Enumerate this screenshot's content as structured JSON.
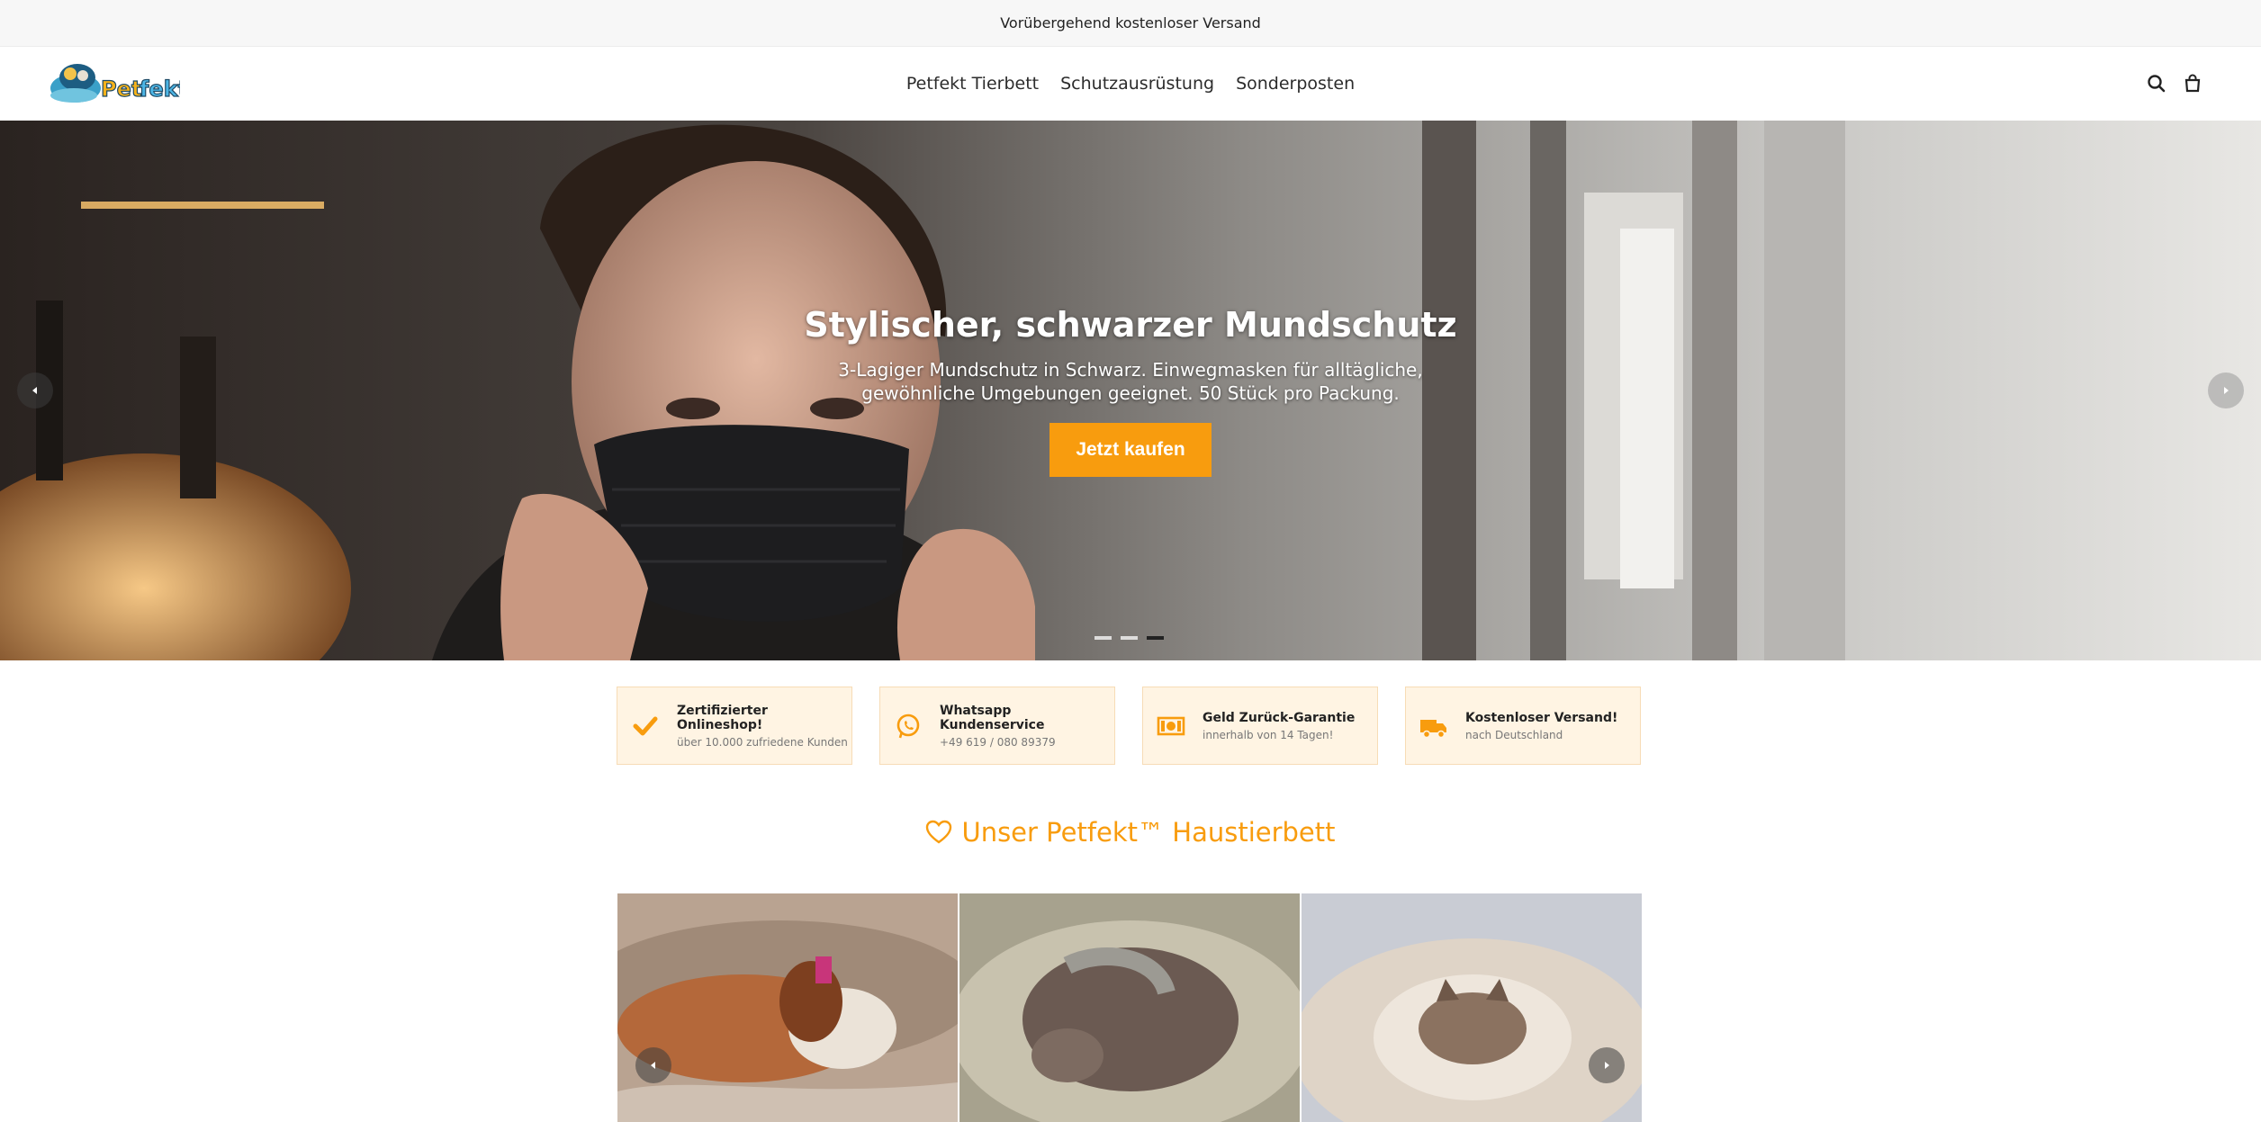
{
  "announcement": "Vorübergehend kostenloser Versand",
  "header": {
    "logo_text": "Petfekt",
    "nav": [
      "Petfekt Tierbett",
      "Schutzausrüstung",
      "Sonderposten"
    ]
  },
  "hero": {
    "title": "Stylischer, schwarzer Mundschutz",
    "subtitle": "3-Lagiger Mundschutz in Schwarz. Einwegmasken für alltägliche, gewöhnliche Umgebungen geeignet. 50 Stück pro Packung.",
    "button": "Jetzt kaufen",
    "slide_count": 3,
    "active_slide": 3
  },
  "features": [
    {
      "title": "Zertifizierter Onlineshop!",
      "sub": "über 10.000 zufriedene Kunden",
      "icon": "check-icon"
    },
    {
      "title": "Whatsapp Kundenservice",
      "sub": "+49 619 / 080 89379",
      "icon": "whatsapp-icon"
    },
    {
      "title": "Geld Zurück-Garantie",
      "sub": "innerhalb von 14 Tagen!",
      "icon": "money-icon"
    },
    {
      "title": "Kostenloser Versand!",
      "sub": "nach Deutschland",
      "icon": "truck-icon"
    }
  ],
  "section": {
    "title": "Unser Petfekt™ Haustierbett",
    "icon": "heart-icon"
  },
  "colors": {
    "accent": "#f89c0e",
    "feature_bg": "#fff4e3",
    "announce_bg": "#f7f7f7"
  }
}
